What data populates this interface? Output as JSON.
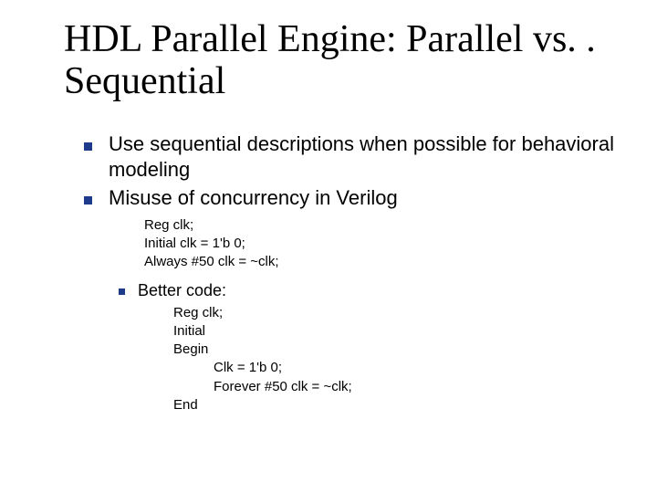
{
  "title": "HDL Parallel Engine: Parallel vs. . Sequential",
  "bullets": {
    "b1": "Use sequential descriptions when possible for behavioral modeling",
    "b2": "Misuse of concurrency in Verilog"
  },
  "code1": {
    "l1": "Reg clk;",
    "l2": "Initial clk = 1'b 0;",
    "l3": "Always #50 clk = ~clk;"
  },
  "subbullet": "Better code:",
  "code2": {
    "l1": "Reg clk;",
    "l2": "Initial",
    "l3": "Begin",
    "l4": "Clk = 1'b 0;",
    "l5": "Forever #50 clk = ~clk;",
    "l6": "End"
  }
}
